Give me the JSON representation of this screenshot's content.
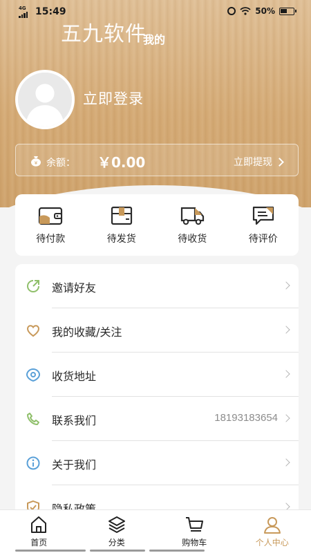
{
  "status_bar": {
    "network": "4G",
    "time": "15:49",
    "battery": "50%"
  },
  "header": {
    "watermark": "五九软件",
    "title": "我的",
    "login_text": "立即登录",
    "balance_label": "余额：",
    "balance_value": "￥0.00",
    "withdraw_label": "立即提现"
  },
  "orders": [
    {
      "label": "待付款",
      "icon": "wallet-icon"
    },
    {
      "label": "待发货",
      "icon": "package-icon"
    },
    {
      "label": "待收货",
      "icon": "truck-icon"
    },
    {
      "label": "待评价",
      "icon": "comment-icon"
    }
  ],
  "menu": [
    {
      "label": "邀请好友",
      "value": "",
      "icon": "invite-icon"
    },
    {
      "label": "我的收藏/关注",
      "value": "",
      "icon": "heart-icon"
    },
    {
      "label": "收货地址",
      "value": "",
      "icon": "location-icon"
    },
    {
      "label": "联系我们",
      "value": "18193183654",
      "icon": "phone-icon"
    },
    {
      "label": "关于我们",
      "value": "",
      "icon": "info-icon"
    },
    {
      "label": "隐私政策",
      "value": "",
      "icon": "shield-icon"
    }
  ],
  "tabs": [
    {
      "label": "首页",
      "icon": "home-icon",
      "active": false
    },
    {
      "label": "分类",
      "icon": "layers-icon",
      "active": false
    },
    {
      "label": "购物车",
      "icon": "cart-icon",
      "active": false
    },
    {
      "label": "个人中心",
      "icon": "user-icon",
      "active": true
    }
  ],
  "colors": {
    "accent": "#c8995a",
    "wood_light": "#e0c097",
    "wood_dark": "#cfa36c"
  }
}
